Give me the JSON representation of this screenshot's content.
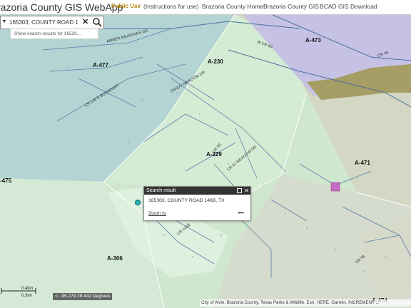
{
  "header": {
    "app_title": "razoria County GIS WebApp",
    "public_use": "Public Use",
    "links": [
      "(Instructions for use)",
      "Brazoria County Home",
      "Brazoria County GIS",
      "BCAD GIS Download"
    ]
  },
  "search": {
    "value": "165303, COUNTY ROAD 1",
    "suggestion": "Show search results for 16530..."
  },
  "map": {
    "abstracts": [
      "A-477",
      "A-230",
      "A-473",
      "A-229",
      "A-471",
      "-475",
      "A-306",
      "A-474"
    ],
    "roads": {
      "amber_meadows": "AMBER MEADOWS DR",
      "county_road_146": "CR 146 E BOUNDARY",
      "sandy_meadow": "SANDY MEADOW DR",
      "cr_57": "CR 57 MEADOW DR",
      "cr_59": "CR 59",
      "cr_146b": "CR 146B",
      "cr_58": "CR 58",
      "wcr_60": "W CR 60",
      "cr_48": "CR 48"
    },
    "colors": {
      "teal_zone": "#b3d4d3",
      "green_zone": "#cfe6cf",
      "light_green": "#dcefdc",
      "olive_zone": "#d3d7c3",
      "purple_zone": "#c5c2e4",
      "brown_band": "#a59d64",
      "pink_zone": "#ede2e6"
    }
  },
  "popup": {
    "title": "Search result",
    "address": "165303, COUNTY ROAD 146B, TX",
    "zoom_label": "Zoom to"
  },
  "scale": {
    "km_label": "0.4km",
    "mi_label": "0.3mi"
  },
  "coords": {
    "text": "-95.279 29.442 Degrees"
  },
  "attribution": "City of Alvin, Brazoria County, Texas Parks & Wildlife, Esri, HERE, Garmin, INCREMENT ..."
}
